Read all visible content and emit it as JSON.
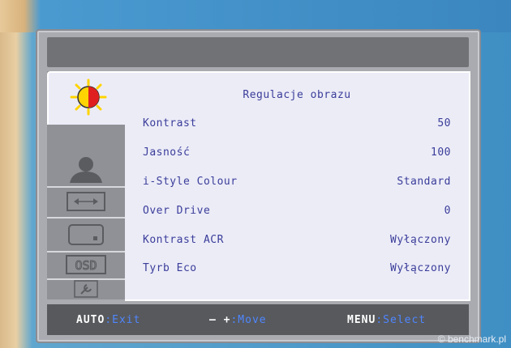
{
  "menu": {
    "title": "Regulacje obrazu",
    "items": [
      {
        "label": "Kontrast",
        "value": "50"
      },
      {
        "label": "Jasność",
        "value": "100"
      },
      {
        "label": "i-Style Colour",
        "value": "Standard"
      },
      {
        "label": "Over Drive",
        "value": "0"
      },
      {
        "label": "Kontrast ACR",
        "value": "Wyłączony"
      },
      {
        "label": "Tyrb Eco",
        "value": "Wyłączony"
      }
    ]
  },
  "tabs": [
    {
      "icon": "sun-icon",
      "active": true
    },
    {
      "icon": "person-icon"
    },
    {
      "icon": "screen-position-icon"
    },
    {
      "icon": "setup-icon"
    },
    {
      "icon": "osd-label-icon",
      "label": "OSD"
    },
    {
      "icon": "wrench-icon"
    }
  ],
  "footer": {
    "auto_key": "AUTO",
    "auto_action": ":Exit",
    "move_key": "— +",
    "move_action": ":Move",
    "menu_key": "MENU",
    "menu_action": ":Select"
  },
  "watermark": "© benchmark.pl",
  "colors": {
    "text": "#3a3d9a",
    "panel": "#ececf7",
    "footer_bg": "#57595d",
    "accent_action": "#4f86ff",
    "sun_red": "#e02020",
    "sun_yellow": "#ffd400"
  }
}
